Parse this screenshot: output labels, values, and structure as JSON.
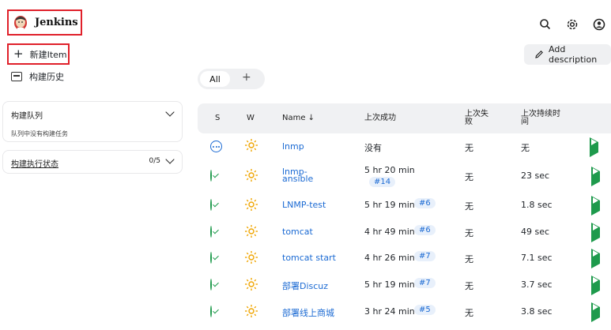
{
  "header": {
    "app_title": "Jenkins",
    "icons": [
      "search-icon",
      "gear-icon",
      "user-icon"
    ]
  },
  "sidebar": {
    "new_item_label": "新建Item",
    "history_label": "构建历史",
    "build_queue": {
      "title": "构建队列",
      "empty_text": "队列中没有构建任务"
    },
    "executor_status": {
      "title": "构建执行状态",
      "count": "0/5"
    }
  },
  "toolbar": {
    "add_description_label": "Add description"
  },
  "tabs": {
    "all_label": "All",
    "add_label": "+"
  },
  "table": {
    "headers": {
      "s": "S",
      "w": "W",
      "name": "Name ↓",
      "last_success": "上次成功",
      "last_failure_1": "上次失",
      "last_failure_2": "败",
      "last_duration_1": "上次持续时",
      "last_duration_2": "间"
    },
    "rows": [
      {
        "status": "pending",
        "name": "lnmp",
        "last_success": "没有",
        "build": "",
        "last_failure": "无",
        "duration": "无"
      },
      {
        "status": "success",
        "name_1": "lnmp-",
        "name_2": "ansible",
        "last_success": "5 hr 20 min",
        "build": "#14",
        "last_failure": "无",
        "duration": "23 sec"
      },
      {
        "status": "success",
        "name": "LNMP-test",
        "last_success": "5 hr 19 min",
        "build": "#6",
        "last_failure": "无",
        "duration": "1.8 sec"
      },
      {
        "status": "success",
        "name": "tomcat",
        "last_success": "4 hr 49 min",
        "build": "#6",
        "last_failure": "无",
        "duration": "49 sec"
      },
      {
        "status": "success",
        "name": "tomcat start",
        "last_success": "4 hr 26 min",
        "build": "#7",
        "last_failure": "无",
        "duration": "7.1 sec"
      },
      {
        "status": "success",
        "name": "部署Discuz",
        "last_success": "5 hr 19 min",
        "build": "#7",
        "last_failure": "无",
        "duration": "3.7 sec"
      },
      {
        "status": "success",
        "name": "部署线上商城",
        "last_success": "3 hr 24 min",
        "build": "#5",
        "last_failure": "无",
        "duration": "3.8 sec"
      }
    ]
  },
  "colors": {
    "highlight_border": "#e0202a",
    "link": "#1b6ad3",
    "success": "#1e9a4c",
    "weather": "#f0a500"
  }
}
